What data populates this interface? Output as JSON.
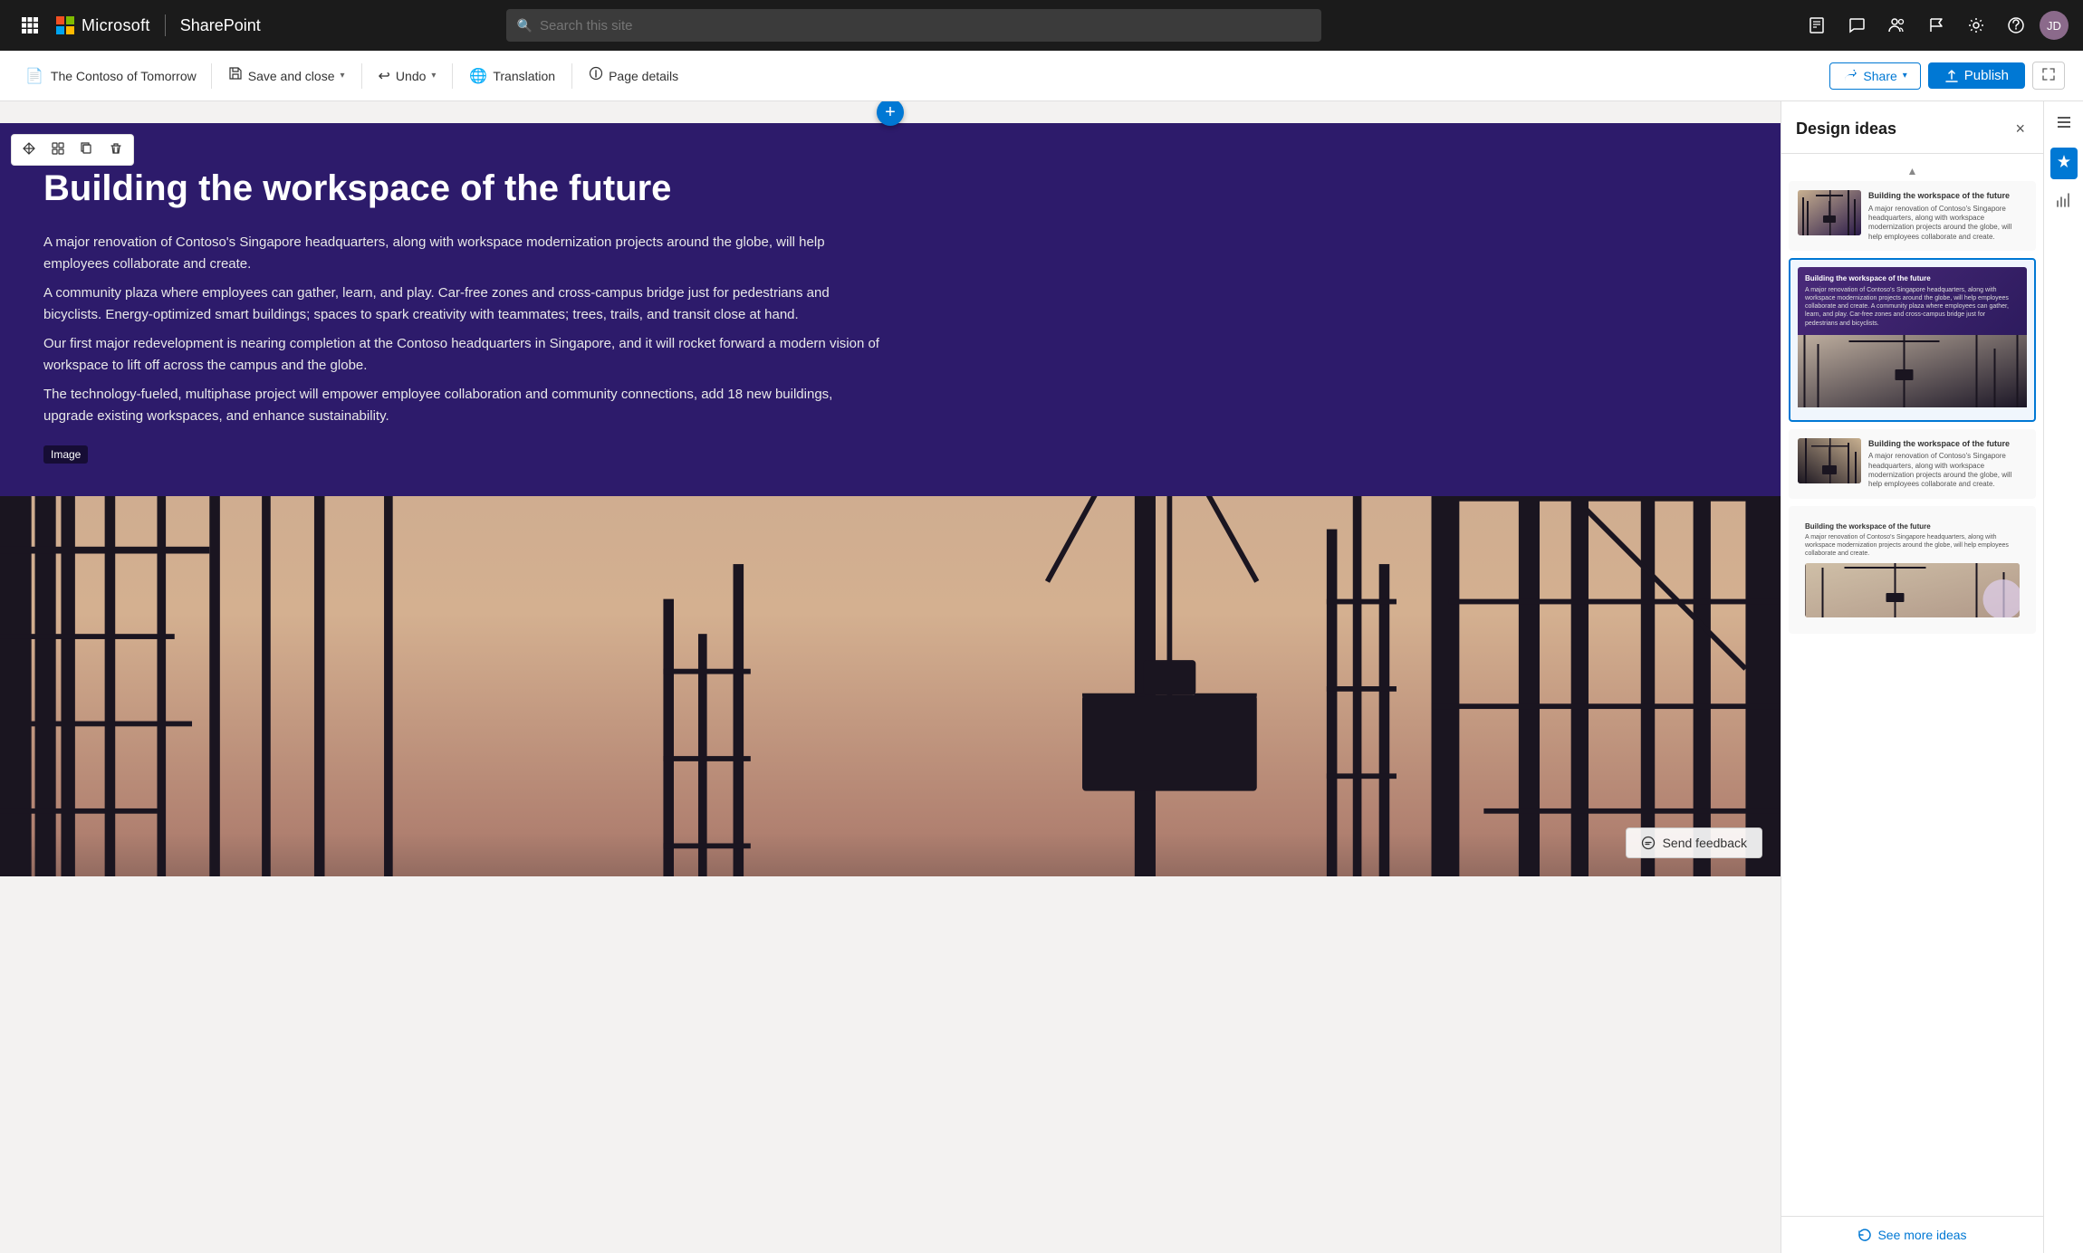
{
  "topnav": {
    "waffle_icon": "⊞",
    "brand": "Microsoft",
    "product": "SharePoint",
    "search_placeholder": "Search this site",
    "avatar_initials": "JD"
  },
  "toolbar": {
    "doc_name": "The Contoso of Tomorrow",
    "save_close_label": "Save and close",
    "undo_label": "Undo",
    "translation_label": "Translation",
    "page_details_label": "Page details",
    "share_label": "Share",
    "publish_label": "Publish"
  },
  "content": {
    "title": "Building the workspace of the future",
    "body_paragraphs": [
      "A major renovation of Contoso's Singapore headquarters, along with workspace modernization projects around the globe, will help employees collaborate and create.",
      "A community plaza where employees can gather, learn, and play. Car-free zones and cross-campus bridge just for pedestrians and bicyclists. Energy-optimized smart buildings; spaces to spark creativity with teammates; trees, trails, and transit close at hand.",
      "Our first major redevelopment is nearing completion at the Contoso headquarters in Singapore, and it will rocket forward a modern vision of workspace to lift off across the campus and the globe.",
      "The technology-fueled, multiphase project will empower employee collaboration and community connections, add 18 new buildings, upgrade existing workspaces, and enhance sustainability."
    ],
    "image_label": "Image",
    "send_feedback_label": "Send feedback"
  },
  "design_panel": {
    "title": "Design ideas",
    "close_label": "×",
    "card1": {
      "title": "Building the workspace of the future",
      "text": "A major renovation of Contoso's Singapore headquarters, along with workspace modernization projects around the globe, will help employees collaborate and create."
    },
    "card2": {
      "title": "Building the workspace of the future",
      "text": "A major renovation of Contoso's Singapore headquarters, along with workspace modernization projects around the globe, will help employees collaborate and create. A community plaza where employees can gather, learn, and play. Car-free zones and cross-campus bridge just for pedestrians and bicyclists."
    },
    "card3": {
      "title": "Building the workspace of the future",
      "text": "A major renovation of Contoso's Singapore headquarters, along with workspace modernization projects around the globe, will help employees collaborate and create."
    },
    "card4": {
      "title": "Building the workspace of the future",
      "text": "A major renovation of Contoso's Singapore headquarters, along with workspace modernization projects around the globe, will help employees collaborate and create."
    },
    "see_more_label": "See more ideas"
  }
}
